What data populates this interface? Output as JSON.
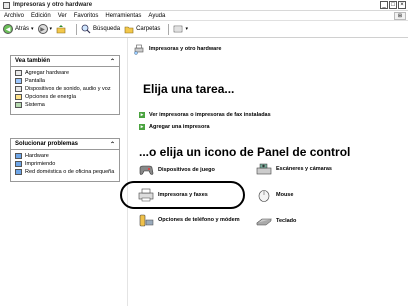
{
  "window": {
    "title": "Impresoras y otro hardware"
  },
  "menu": [
    "Archivo",
    "Edición",
    "Ver",
    "Favoritos",
    "Herramientas",
    "Ayuda"
  ],
  "toolbar": {
    "back": "Atrás",
    "search": "Búsqueda",
    "folders": "Carpetas"
  },
  "sidebar": {
    "see_also": {
      "title": "Vea también",
      "items": [
        "Agregar hardware",
        "Pantalla",
        "Dispositivos de sonido, audio y voz",
        "Opciones de energía",
        "Sistema"
      ]
    },
    "troubleshoot": {
      "title": "Solucionar problemas",
      "items": [
        "Hardware",
        "Imprimiendo",
        "Red doméstica o de oficina pequeña"
      ]
    }
  },
  "main": {
    "breadcrumb": "Impresoras y otro hardware",
    "task_heading": "Elija una tarea...",
    "tasks": [
      "Ver impresoras o impresoras de fax instaladas",
      "Agregar una impresora"
    ],
    "icon_heading": "...o elija un icono de Panel de control",
    "categories": [
      {
        "label": "Dispositivos de juego",
        "icon": "gamepad-icon"
      },
      {
        "label": "Escáneres y cámaras",
        "icon": "scanner-icon"
      },
      {
        "label": "Impresoras y faxes",
        "icon": "printer-icon"
      },
      {
        "label": "Mouse",
        "icon": "mouse-icon"
      },
      {
        "label": "Opciones de teléfono y módem",
        "icon": "phone-icon"
      },
      {
        "label": "Teclado",
        "icon": "keyboard-icon"
      }
    ]
  },
  "colors": {
    "accent_green": "#4aa33f",
    "highlight_circle": "#000000"
  }
}
